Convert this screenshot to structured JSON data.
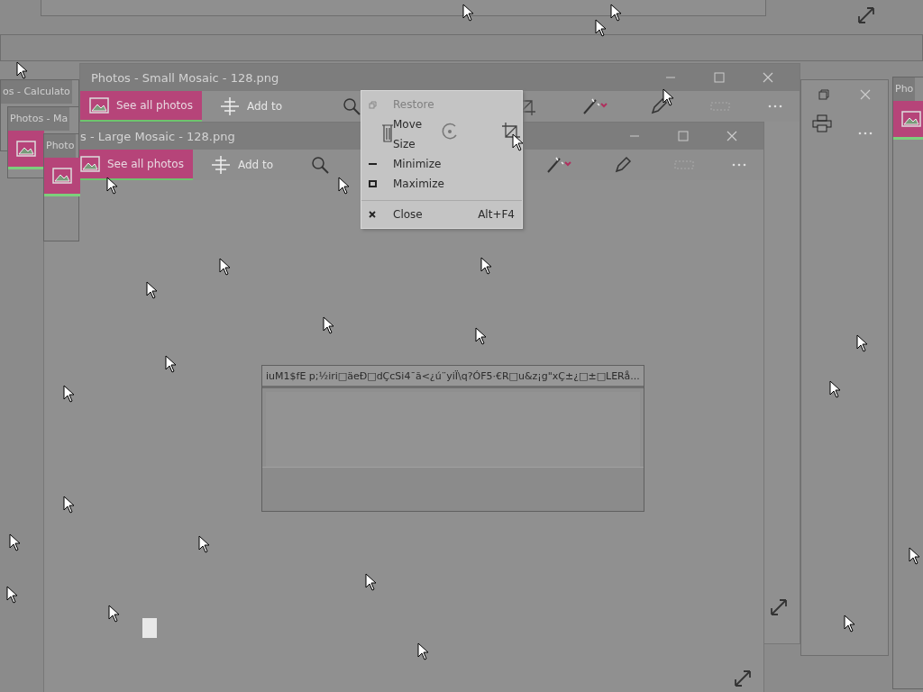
{
  "side_windows": [
    {
      "title": "os - Calculato",
      "tile": false
    },
    {
      "title": "Photos - Ma",
      "tile": true
    },
    {
      "title": "Photo",
      "tile": true
    },
    {
      "title": "Pho",
      "tile": true
    }
  ],
  "main_windows": [
    {
      "title": "Photos - Small Mosaic - 128.png",
      "see_all": "See all photos",
      "add_to": "Add to"
    },
    {
      "title": "s - Large Mosaic - 128.png",
      "see_all": "See all photos",
      "add_to": "Add to"
    }
  ],
  "context_menu": {
    "items": [
      {
        "label": "Restore",
        "kind": "restore",
        "disabled": true
      },
      {
        "label": "Move",
        "kind": "plain",
        "disabled": false
      },
      {
        "label": "Size",
        "kind": "plain",
        "disabled": false
      },
      {
        "label": "Minimize",
        "kind": "minimize",
        "disabled": false
      },
      {
        "label": "Maximize",
        "kind": "maximize",
        "disabled": false
      },
      {
        "label": "Close",
        "kind": "close",
        "disabled": false,
        "shortcut": "Alt+F4"
      }
    ]
  },
  "dialog": {
    "title": "iuM1$fE  p;½iri□äeÐ□dÇcSi4¯ã<¿ú¨yiÏ\\q?ÓF5·€R□u&z¡g\"xÇ±¿□±□LERå..."
  }
}
